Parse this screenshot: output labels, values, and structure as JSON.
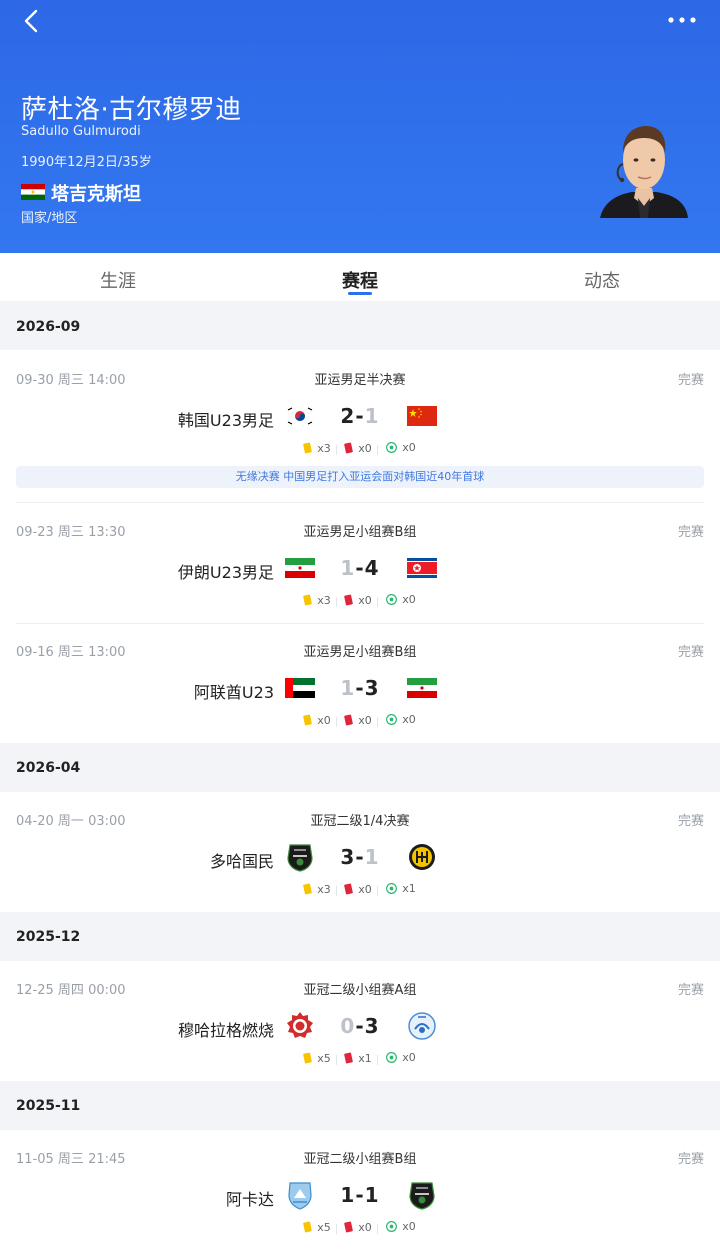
{
  "header": {
    "name_cn": "萨杜洛·古尔穆罗迪",
    "name_en": "Sadullo Gulmurodi",
    "birth": "1990年12月2日/35岁",
    "country": "塔吉克斯坦",
    "country_label": "国家/地区",
    "brand_color": "#2d6ef0"
  },
  "tabs": [
    "生涯",
    "赛程",
    "动态"
  ],
  "active_tab": "赛程",
  "months": [
    "2026-09",
    "2026-04",
    "2025-12",
    "2025-11"
  ],
  "matches": [
    {
      "date": "09-30",
      "weekday": "周三",
      "time": "14:00",
      "competition": "亚运男足半决赛",
      "status": "完赛",
      "home": "韩国U23男足",
      "away": "中国U23男足",
      "home_score": "2",
      "away_score": "1",
      "yellow": "x3",
      "red": "x0",
      "goals": "x0",
      "news": "无缘决赛 中国男足打入亚运会面对韩国近40年首球"
    },
    {
      "date": "09-23",
      "weekday": "周三",
      "time": "13:30",
      "competition": "亚运男足小组赛B组",
      "status": "完赛",
      "home": "伊朗U23男足",
      "away": "朝鲜U23男足",
      "home_score": "1",
      "away_score": "4",
      "yellow": "x3",
      "red": "x0",
      "goals": "x0"
    },
    {
      "date": "09-16",
      "weekday": "周三",
      "time": "13:00",
      "competition": "亚运男足小组赛B组",
      "status": "完赛",
      "home": "阿联酋U23",
      "away": "伊朗U23",
      "home_score": "1",
      "away_score": "3",
      "yellow": "x0",
      "red": "x0",
      "goals": "x0"
    },
    {
      "date": "04-20",
      "weekday": "周一",
      "time": "03:00",
      "competition": "亚冠二级1/4决赛",
      "status": "完赛",
      "home": "多哈国民",
      "away": "侯赛因",
      "home_score": "3",
      "away_score": "1",
      "yellow": "x3",
      "red": "x0",
      "goals": "x1"
    },
    {
      "date": "12-25",
      "weekday": "周四",
      "time": "00:00",
      "competition": "亚冠二级小组赛A组",
      "status": "完赛",
      "home": "穆哈拉格燃烧",
      "away": "德黑兰独立",
      "home_score": "0",
      "away_score": "3",
      "yellow": "x5",
      "red": "x1",
      "goals": "x0"
    },
    {
      "date": "11-05",
      "weekday": "周三",
      "time": "21:45",
      "competition": "亚冠二级小组赛B组",
      "status": "完赛",
      "home": "阿卡达",
      "away": "多哈国民",
      "home_score": "1",
      "away_score": "1",
      "yellow": "x5",
      "red": "x0",
      "goals": "x0"
    }
  ]
}
